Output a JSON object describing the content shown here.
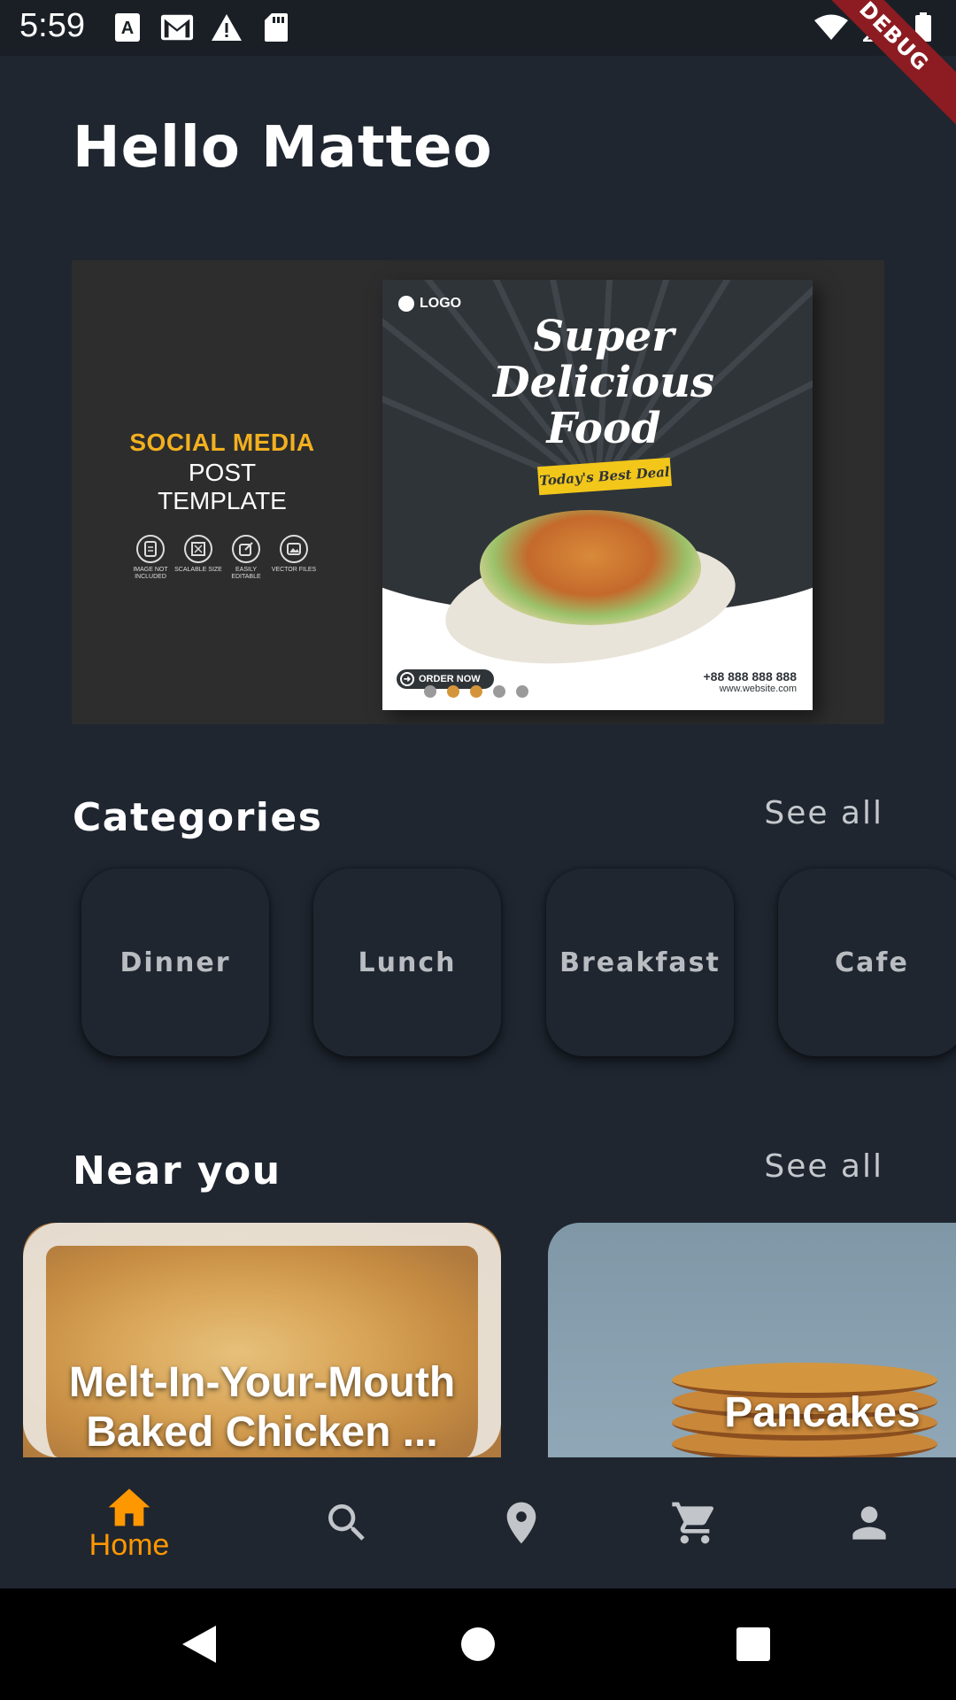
{
  "status_bar": {
    "time": "5:59",
    "left_icons": [
      "font-icon",
      "gmail-icon",
      "warning-icon",
      "sd-card-icon"
    ],
    "right_icons": [
      "wifi-icon",
      "signal-icon",
      "battery-icon"
    ]
  },
  "debug_ribbon": "DEBUG",
  "greeting": "Hello Matteo",
  "banner": {
    "left_heading": "SOCIAL MEDIA",
    "left_subheading": "POST TEMPLATE",
    "features": [
      "IMAGE NOT INCLUDED",
      "SCALABLE SIZE",
      "EASILY EDITABLE",
      "VECTOR FILES"
    ],
    "poster": {
      "logo": "LOGO",
      "title_lines": [
        "Super",
        "Delicious",
        "Food"
      ],
      "deal": "Today's Best Deal",
      "order_button": "ORDER NOW",
      "phone": "+88 888 888 888",
      "website": "www.website.com"
    },
    "carousel": {
      "count": 5,
      "active": [
        1,
        2
      ]
    }
  },
  "categories": {
    "title": "Categories",
    "see_all": "See all",
    "items": [
      "Dinner",
      "Lunch",
      "Breakfast",
      "Cafe"
    ]
  },
  "near_you": {
    "title": "Near you",
    "see_all": "See all",
    "items": [
      {
        "title": "Melt-In-Your-Mouth Baked Chicken ..."
      },
      {
        "title": "Pancakes"
      }
    ]
  },
  "bottom_nav": {
    "items": [
      {
        "icon": "home-icon",
        "label": "Home",
        "active": true
      },
      {
        "icon": "search-icon",
        "label": "",
        "active": false
      },
      {
        "icon": "location-pin-icon",
        "label": "",
        "active": false
      },
      {
        "icon": "cart-icon",
        "label": "",
        "active": false
      },
      {
        "icon": "person-icon",
        "label": "",
        "active": false
      }
    ]
  },
  "colors": {
    "background": "#1f2630",
    "accent": "#ff9800",
    "inactive_icon": "#c2c5c9",
    "dot_active": "#d4953a"
  },
  "system_nav": [
    "back-icon",
    "home-circle-icon",
    "recents-icon"
  ]
}
